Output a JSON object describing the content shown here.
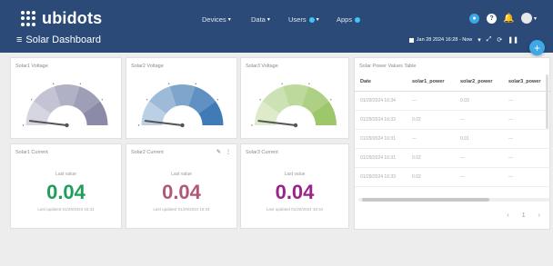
{
  "brand": {
    "name": "ubidots"
  },
  "nav": {
    "devices": "Devices",
    "data": "Data",
    "users": "Users",
    "apps": "Apps"
  },
  "icons": {
    "top": [
      "notification-badge-icon",
      "help-icon",
      "bell-icon",
      "user-avatar-icon"
    ],
    "subbar": [
      "menu-icon",
      "calendar-icon",
      "expand-icon",
      "refresh-icon",
      "pause-icon"
    ],
    "fab": "plus-icon"
  },
  "dashboard": {
    "title": "Solar Dashboard",
    "date_range": "Jan 28 2024 16:28 - Now",
    "accent": "#3ea7e8",
    "header_bg": "#2b4a78"
  },
  "gauges": [
    {
      "title": "Solar1 Voltage",
      "color": "#8a8aa8",
      "level": 0.0
    },
    {
      "title": "Solar2 Voltage",
      "color": "#3f7ab5",
      "level": 0.0
    },
    {
      "title": "Solar3 Voltage",
      "color": "#9dc66b",
      "level": 0.0
    }
  ],
  "metrics": [
    {
      "title": "Solar1 Current",
      "label": "Last value",
      "value": "0.04",
      "color": "#1e9e5a",
      "updated": "Last updated 01/29/2024 16:31"
    },
    {
      "title": "Solar2 Current",
      "label": "Last value",
      "value": "0.04",
      "color": "#b1577a",
      "updated": "Last updated 01/29/2024 16:34"
    },
    {
      "title": "Solar3 Current",
      "label": "Last value",
      "value": "0.04",
      "color": "#9a2389",
      "updated": "Last updated 01/29/2024 16:34"
    }
  ],
  "table": {
    "title": "Solar Power Values Table",
    "columns": [
      "Date",
      "solar1_power",
      "solar2_power",
      "solar3_power"
    ],
    "rows": [
      [
        "01/29/2024 16:34",
        "---",
        "0.03",
        "---"
      ],
      [
        "01/29/2024 16:33",
        "0.02",
        "---",
        "---"
      ],
      [
        "01/29/2024 16:31",
        "---",
        "0.01",
        "---"
      ],
      [
        "01/29/2024 16:31",
        "0.02",
        "---",
        "---"
      ],
      [
        "01/29/2024 16:33",
        "0.02",
        "---",
        "---"
      ]
    ],
    "page": "1"
  }
}
